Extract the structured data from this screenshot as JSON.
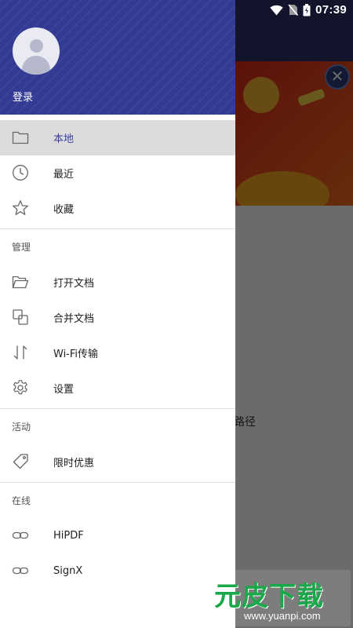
{
  "status_bar": {
    "time": "07:39",
    "icons": [
      "wifi-icon",
      "no-sim-icon",
      "battery-icon"
    ]
  },
  "drawer": {
    "header": {
      "login_label": "登录"
    },
    "items_primary": [
      {
        "label": "本地",
        "icon": "folder-icon",
        "selected": true
      },
      {
        "label": "最近",
        "icon": "clock-icon",
        "selected": false
      },
      {
        "label": "收藏",
        "icon": "star-icon",
        "selected": false
      }
    ],
    "sections": {
      "manage": {
        "title": "管理",
        "items": [
          {
            "label": "打开文档",
            "icon": "folder-open-icon"
          },
          {
            "label": "合并文档",
            "icon": "merge-icon"
          },
          {
            "label": "Wi-Fi传输",
            "icon": "transfer-icon"
          },
          {
            "label": "设置",
            "icon": "gear-icon"
          }
        ]
      },
      "activity": {
        "title": "活动",
        "items": [
          {
            "label": "限时优惠",
            "icon": "tag-icon"
          }
        ]
      },
      "online": {
        "title": "在线",
        "items": [
          {
            "label": "HiPDF",
            "icon": "link-icon"
          },
          {
            "label": "SignX",
            "icon": "link-icon"
          }
        ]
      }
    }
  },
  "background": {
    "partial_text": "路径",
    "close_glyph": "✕"
  },
  "watermark": {
    "logo_text": "元皮下载",
    "url": "www.yuanpi.com"
  },
  "colors": {
    "header_blue": "#323a93",
    "selected_text": "#3a3f9a",
    "selected_bg": "#dcdcdc"
  }
}
